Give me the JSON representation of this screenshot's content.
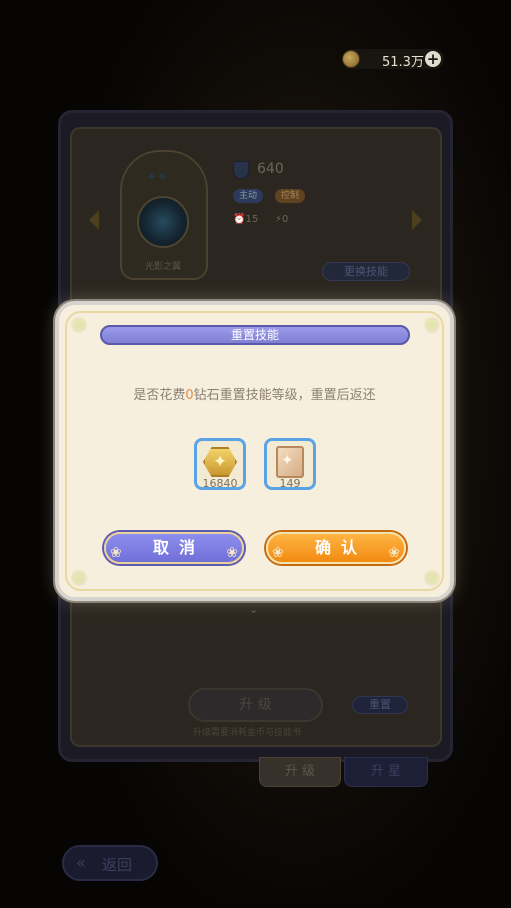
{
  "currency": {
    "amount": "51.3万",
    "plus_symbol": "+"
  },
  "background": {
    "power_value": "640",
    "tags": [
      "主动",
      "控制"
    ],
    "stats": [
      "15",
      "0"
    ],
    "card_label": "光影之翼",
    "change_skill_label": "更换技能",
    "upgrade_label": "升 级",
    "upgrade_note": "升级需要消耗金币与技能书",
    "reset_label": "重置",
    "tabs": [
      "升 级",
      "升 星"
    ],
    "back_label": "返回"
  },
  "modal": {
    "title": "重置技能",
    "message_prefix": "是否花费",
    "message_amount": "0",
    "message_suffix": "钻石重置技能等级，重置后返还",
    "items": [
      {
        "icon": "gold-coin-icon",
        "count": "16840"
      },
      {
        "icon": "skill-book-icon",
        "count": "149"
      }
    ],
    "cancel_label": "取消",
    "confirm_label": "确认"
  },
  "colors": {
    "title_bar": "#8a8ae0",
    "cancel_button": "#7f7fe4",
    "confirm_button": "#f9a12a",
    "highlight": "#e98a3a",
    "modal_background": "#f7efdd"
  }
}
